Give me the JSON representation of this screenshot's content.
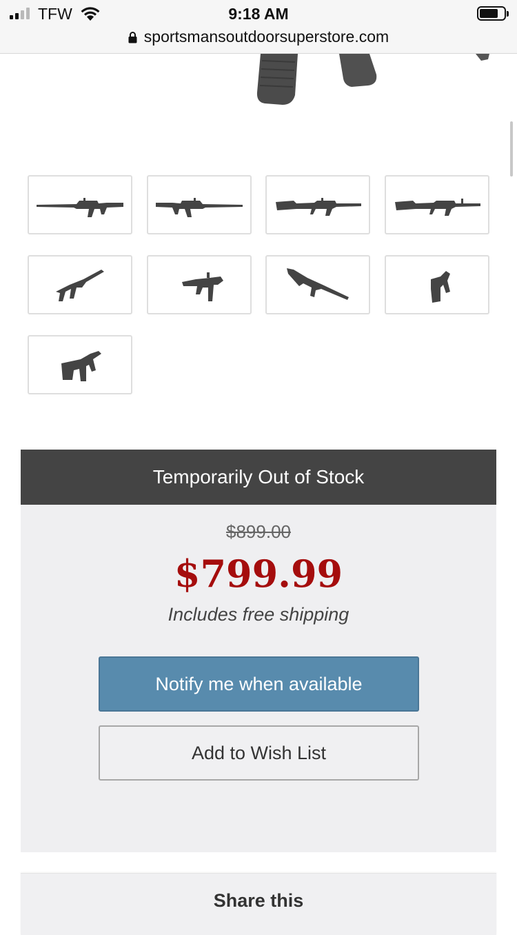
{
  "status_bar": {
    "carrier": "TFW",
    "time": "9:18 AM",
    "signal_bars_filled": 2,
    "signal_bars_total": 4
  },
  "url_bar": {
    "domain": "sportsmansoutdoorsuperstore.com",
    "secure_icon": "lock-icon"
  },
  "gallery": {
    "thumbnails": [
      {
        "view": "side-right"
      },
      {
        "view": "side-left"
      },
      {
        "view": "side-right-2"
      },
      {
        "view": "side-left-2"
      },
      {
        "view": "angle-front"
      },
      {
        "view": "angle-front-2"
      },
      {
        "view": "diagonal"
      },
      {
        "view": "rear-stock"
      },
      {
        "view": "rear-angle"
      }
    ]
  },
  "purchase": {
    "stock_status": "Temporarily Out of Stock",
    "original_price": "$899.00",
    "sale_price": "$799.99",
    "shipping_note": "Includes free shipping",
    "notify_label": "Notify me when available",
    "wishlist_label": "Add to Wish List"
  },
  "share": {
    "title": "Share this"
  },
  "colors": {
    "stock_header_bg": "#444444",
    "sale_price": "#a50d0d",
    "notify_button": "#588bad",
    "panel_bg": "#efeff1"
  }
}
